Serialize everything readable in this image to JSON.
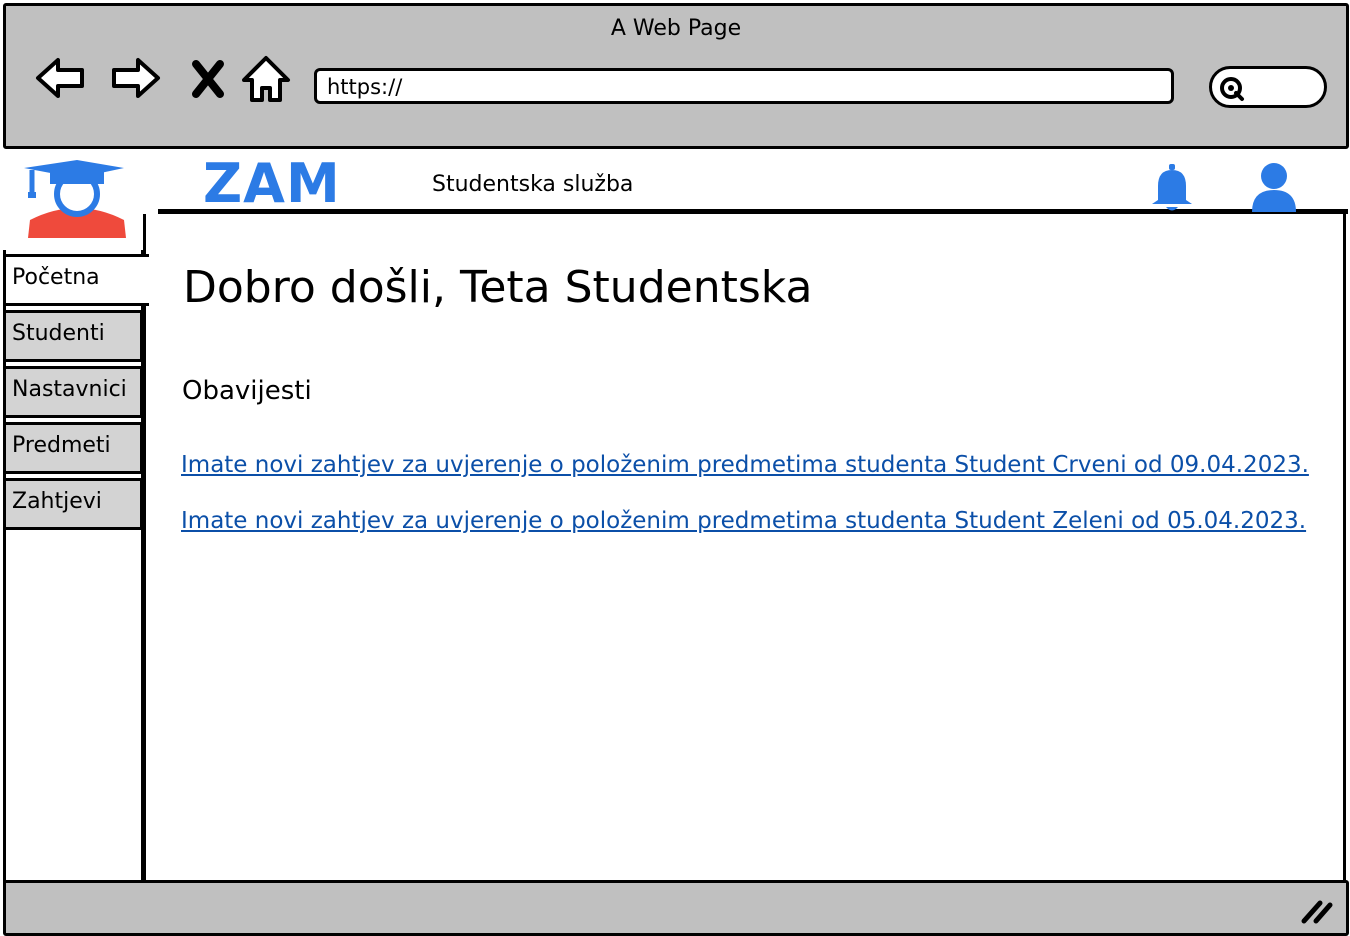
{
  "window": {
    "title": "A Web Page"
  },
  "browser": {
    "url": "https://",
    "icons": [
      "back-arrow-icon",
      "forward-arrow-icon",
      "close-icon",
      "home-icon",
      "search-icon"
    ]
  },
  "header": {
    "brand": "ZAM",
    "subtitle": "Studentska služba",
    "brand_color": "#2c7be5",
    "icons": [
      "notification-bell-icon",
      "user-profile-icon"
    ]
  },
  "sidebar": {
    "items": [
      {
        "label": "Početna",
        "active": true
      },
      {
        "label": "Studenti",
        "active": false
      },
      {
        "label": "Nastavnici",
        "active": false
      },
      {
        "label": "Predmeti",
        "active": false
      },
      {
        "label": "Zahtjevi",
        "active": false
      }
    ]
  },
  "main": {
    "welcome": "Dobro došli, Teta Studentska",
    "section_title": "Obavijesti",
    "notices": [
      "Imate novi zahtjev za uvjerenje o položenim predmetima studenta  Student Crveni od 09.04.2023.",
      "Imate novi zahtjev za uvjerenje o položenim predmetima studenta  Student Zeleni od 05.04.2023."
    ],
    "link_color": "#0b4fa8"
  }
}
